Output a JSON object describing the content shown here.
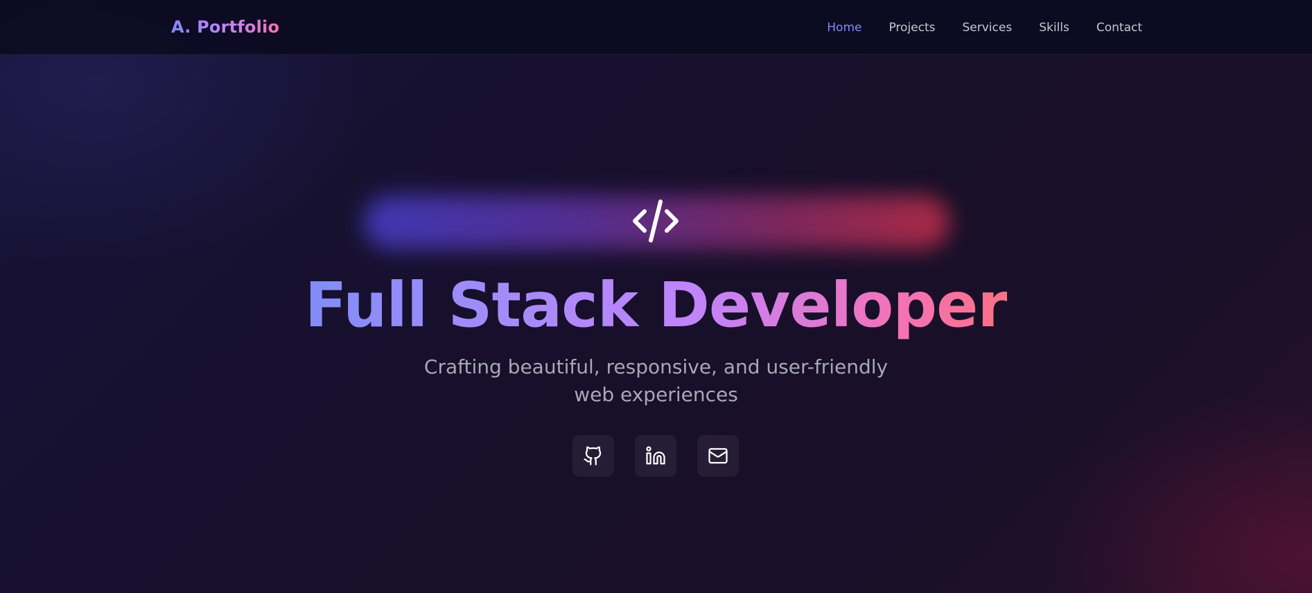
{
  "brand": "A. Portfolio",
  "nav": {
    "items": [
      "Home",
      "Projects",
      "Services",
      "Skills",
      "Contact"
    ],
    "active": "Home"
  },
  "hero": {
    "icon": "code-icon",
    "title": "Full Stack Developer",
    "subtitle": "Crafting beautiful, responsive, and user-friendly web experiences"
  },
  "social_icons": [
    "github-icon",
    "linkedin-icon",
    "mail-icon"
  ],
  "colors": {
    "accent": "#818cf8",
    "gradient_start": "#818cf8",
    "gradient_mid": "#c084fc",
    "gradient_end": "#fb7185",
    "nav_text": "#c7c9d3",
    "subtitle_text": "#a7a8b6"
  }
}
